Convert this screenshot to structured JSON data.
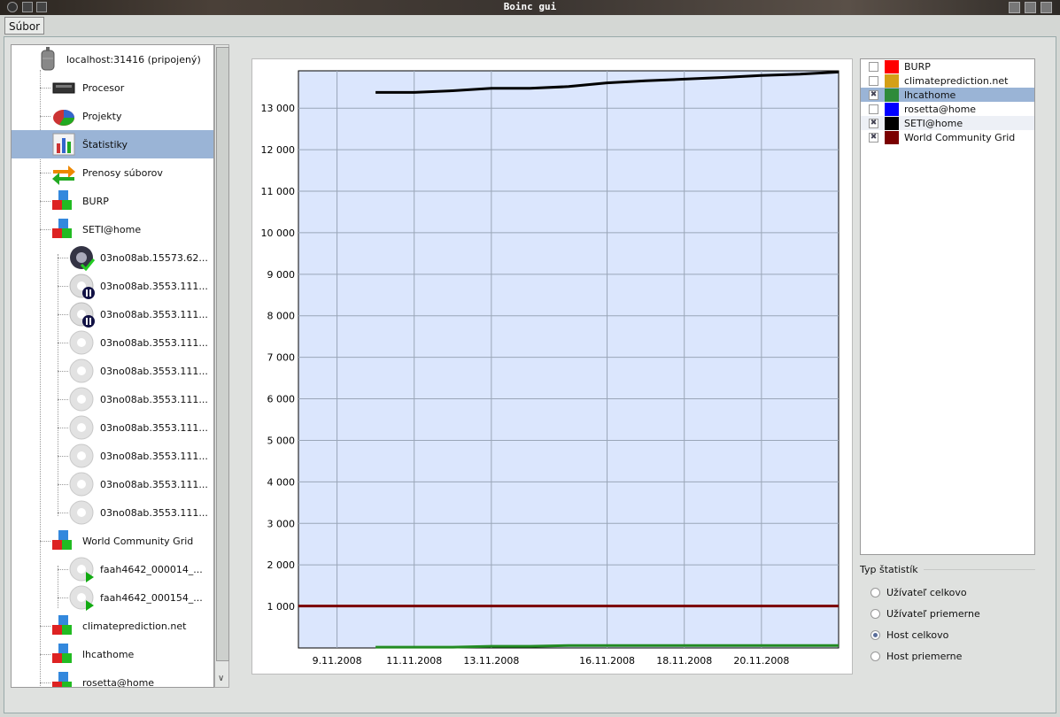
{
  "window": {
    "title": "Boinc gui"
  },
  "menu": {
    "file": "Súbor"
  },
  "tree": {
    "host": "localhost:31416 (pripojený)",
    "items": [
      {
        "label": "Procesor",
        "icon": "cpu-icon"
      },
      {
        "label": "Projekty",
        "icon": "pie-chart-icon"
      },
      {
        "label": "Štatistiky",
        "icon": "bar-chart-icon",
        "selected": true
      },
      {
        "label": "Prenosy súborov",
        "icon": "transfer-arrows-icon"
      },
      {
        "label": "BURP",
        "icon": "project-cubes-icon"
      },
      {
        "label": "SETI@home",
        "icon": "project-cubes-icon"
      },
      {
        "label": "03no08ab.15573.62...",
        "icon": "task-done-icon"
      },
      {
        "label": "03no08ab.3553.111...",
        "icon": "task-paused-icon"
      },
      {
        "label": "03no08ab.3553.111...",
        "icon": "task-paused-icon"
      },
      {
        "label": "03no08ab.3553.111...",
        "icon": "task-gear-icon"
      },
      {
        "label": "03no08ab.3553.111...",
        "icon": "task-gear-icon"
      },
      {
        "label": "03no08ab.3553.111...",
        "icon": "task-gear-icon"
      },
      {
        "label": "03no08ab.3553.111...",
        "icon": "task-gear-icon"
      },
      {
        "label": "03no08ab.3553.111...",
        "icon": "task-gear-icon"
      },
      {
        "label": "03no08ab.3553.111...",
        "icon": "task-gear-icon"
      },
      {
        "label": "03no08ab.3553.111...",
        "icon": "task-gear-icon"
      },
      {
        "label": "World Community Grid",
        "icon": "project-cubes-icon"
      },
      {
        "label": "faah4642_000014_...",
        "icon": "task-running-icon"
      },
      {
        "label": "faah4642_000154_...",
        "icon": "task-running-icon"
      },
      {
        "label": "climateprediction.net",
        "icon": "project-cubes-icon"
      },
      {
        "label": "lhcathome",
        "icon": "project-cubes-icon"
      },
      {
        "label": "rosetta@home",
        "icon": "project-cubes-icon"
      }
    ]
  },
  "legend": {
    "items": [
      {
        "name": "BURP",
        "color": "#ff0000",
        "checked": false
      },
      {
        "name": "climateprediction.net",
        "color": "#d4a017",
        "checked": false
      },
      {
        "name": "lhcathome",
        "color": "#2e8b3a",
        "checked": true
      },
      {
        "name": "rosetta@home",
        "color": "#0000ff",
        "checked": false
      },
      {
        "name": "SETI@home",
        "color": "#000000",
        "checked": true
      },
      {
        "name": "World Community Grid",
        "color": "#7a0000",
        "checked": true
      }
    ]
  },
  "stats_type": {
    "title": "Typ štatistík",
    "options": [
      {
        "label": "Užívateľ celkovo",
        "selected": false
      },
      {
        "label": "Užívateľ priemerne",
        "selected": false
      },
      {
        "label": "Host celkovo",
        "selected": true
      },
      {
        "label": "Host priemerne",
        "selected": false
      }
    ]
  },
  "chart_data": {
    "type": "line",
    "title": "",
    "xlabel": "",
    "ylabel": "",
    "x_ticks": [
      "9.11.2008",
      "11.11.2008",
      "13.11.2008",
      "16.11.2008",
      "18.11.2008",
      "20.11.2008"
    ],
    "y_ticks": [
      "1 000",
      "2 000",
      "3 000",
      "4 000",
      "5 000",
      "6 000",
      "7 000",
      "8 000",
      "9 000",
      "10 000",
      "11 000",
      "12 000",
      "13 000"
    ],
    "ylim": [
      0,
      13900
    ],
    "xlim": [
      "8.11.2008",
      "22.11.2008"
    ],
    "grid": true,
    "series": [
      {
        "color": "#000000",
        "points": [
          [
            "10.11.2008",
            13380
          ],
          [
            "11.11.2008",
            13380
          ],
          [
            "12.11.2008",
            13420
          ],
          [
            "13.11.2008",
            13480
          ],
          [
            "14.11.2008",
            13480
          ],
          [
            "15.11.2008",
            13520
          ],
          [
            "16.11.2008",
            13610
          ],
          [
            "17.11.2008",
            13660
          ],
          [
            "18.11.2008",
            13700
          ],
          [
            "19.11.2008",
            13740
          ],
          [
            "20.11.2008",
            13790
          ],
          [
            "21.11.2008",
            13820
          ],
          [
            "22.11.2008",
            13870
          ]
        ]
      },
      {
        "color": "#7a0000",
        "points": [
          [
            "8.11.2008",
            1010
          ],
          [
            "22.11.2008",
            1010
          ]
        ]
      },
      {
        "color": "#228b22",
        "points": [
          [
            "10.11.2008",
            20
          ],
          [
            "12.11.2008",
            20
          ],
          [
            "13.11.2008",
            40
          ],
          [
            "14.11.2008",
            40
          ],
          [
            "15.11.2008",
            60
          ],
          [
            "22.11.2008",
            60
          ]
        ]
      }
    ]
  }
}
